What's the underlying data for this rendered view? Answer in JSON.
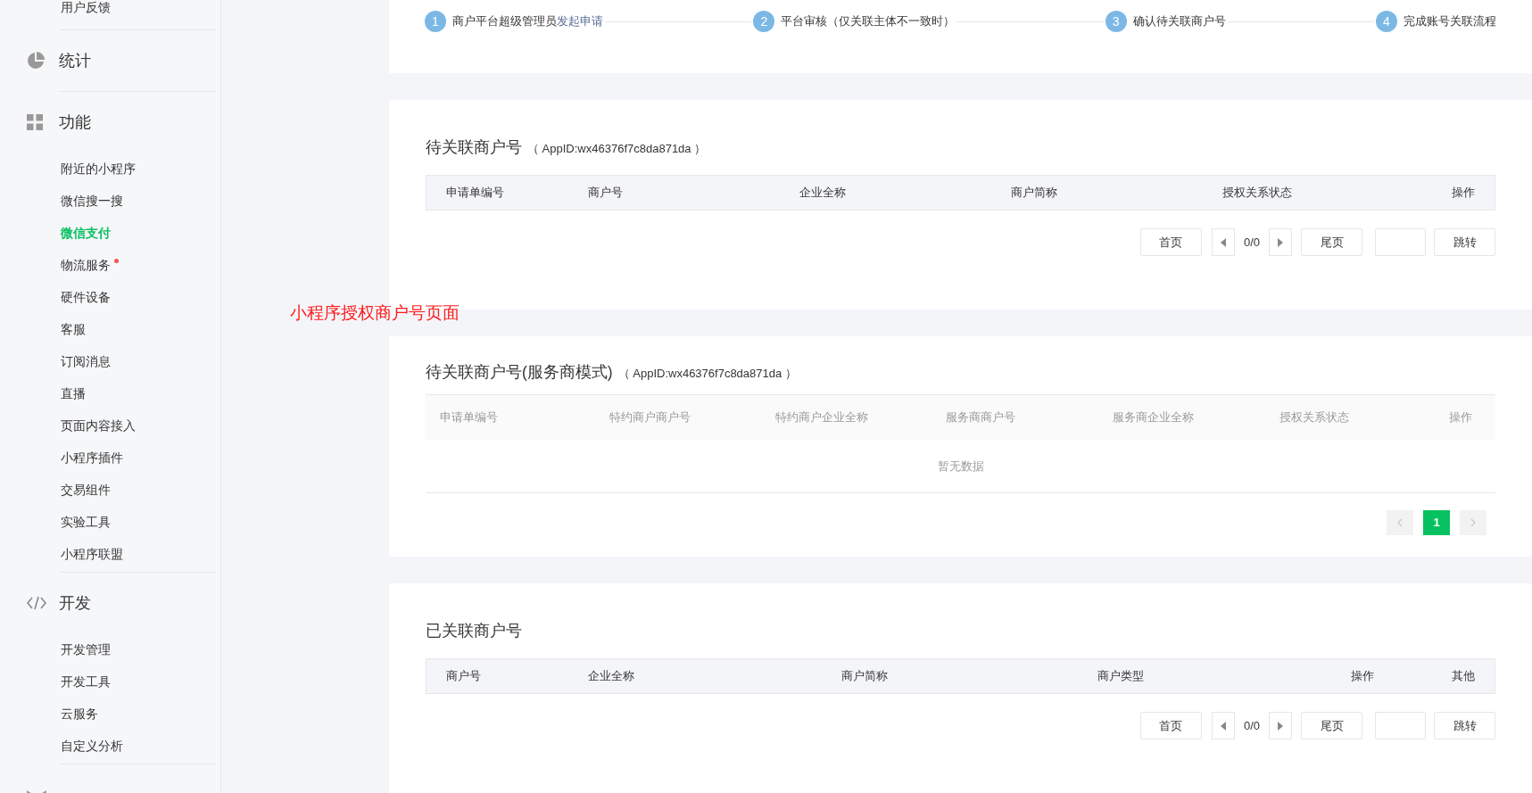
{
  "sidebar": {
    "sections": [
      {
        "kind": "tail",
        "items": [
          {
            "label": "用户反馈",
            "selected": false,
            "badge": false
          }
        ]
      },
      {
        "kind": "stats",
        "title": "统计"
      },
      {
        "kind": "grid",
        "title": "功能",
        "items": [
          {
            "label": "附近的小程序",
            "selected": false,
            "badge": false
          },
          {
            "label": "微信搜一搜",
            "selected": false,
            "badge": false
          },
          {
            "label": "微信支付",
            "selected": true,
            "badge": false
          },
          {
            "label": "物流服务",
            "selected": false,
            "badge": true
          },
          {
            "label": "硬件设备",
            "selected": false,
            "badge": false
          },
          {
            "label": "客服",
            "selected": false,
            "badge": false
          },
          {
            "label": "订阅消息",
            "selected": false,
            "badge": false
          },
          {
            "label": "直播",
            "selected": false,
            "badge": false
          },
          {
            "label": "页面内容接入",
            "selected": false,
            "badge": false
          },
          {
            "label": "小程序插件",
            "selected": false,
            "badge": false
          },
          {
            "label": "交易组件",
            "selected": false,
            "badge": false
          },
          {
            "label": "实验工具",
            "selected": false,
            "badge": false
          },
          {
            "label": "小程序联盟",
            "selected": false,
            "badge": false
          }
        ]
      },
      {
        "kind": "code",
        "title": "开发",
        "items": [
          {
            "label": "开发管理",
            "selected": false,
            "badge": false
          },
          {
            "label": "开发工具",
            "selected": false,
            "badge": false
          },
          {
            "label": "云服务",
            "selected": false,
            "badge": false
          },
          {
            "label": "自定义分析",
            "selected": false,
            "badge": false
          }
        ]
      },
      {
        "kind": "growth"
      }
    ]
  },
  "steps": [
    {
      "number": "1",
      "text": "商户平台超级管理员",
      "link": "发起申请"
    },
    {
      "number": "2",
      "text": "平台审核（仅关联主体不一致时）"
    },
    {
      "number": "3",
      "text": "确认待关联商户号"
    },
    {
      "number": "4",
      "text": "完成账号关联流程"
    }
  ],
  "annotation": "小程序授权商户号页面",
  "sections": [
    {
      "kind": "bordered",
      "title": "待关联商户号",
      "appid": "（ AppID:wx46376f7c8da871da ）",
      "columns": [
        "申请单编号",
        "商户号",
        "企业全称",
        "商户简称",
        "授权关系状态",
        "操作"
      ],
      "pagination": {
        "kind": "jump",
        "first": "首页",
        "page": "0/0",
        "last": "尾页",
        "go": "跳转"
      }
    },
    {
      "kind": "plain",
      "title": "待关联商户号(服务商模式)",
      "appid": "（ AppID:wx46376f7c8da871da ）",
      "columns": [
        "申请单编号",
        "特约商户商户号",
        "特约商户企业全称",
        "服务商商户号",
        "服务商企业全称",
        "授权关系状态",
        "操作"
      ],
      "empty": "暂无数据",
      "pagination": {
        "kind": "numbered",
        "pages": [
          {
            "label": "1",
            "selected": true
          }
        ]
      }
    },
    {
      "kind": "linked",
      "title": "已关联商户号",
      "columns": [
        "商户号",
        "企业全称",
        "商户简称",
        "商户类型",
        "操作",
        "其他"
      ],
      "pagination": {
        "kind": "jump",
        "first": "首页",
        "page": "0/0",
        "last": "尾页",
        "go": "跳转"
      }
    }
  ]
}
